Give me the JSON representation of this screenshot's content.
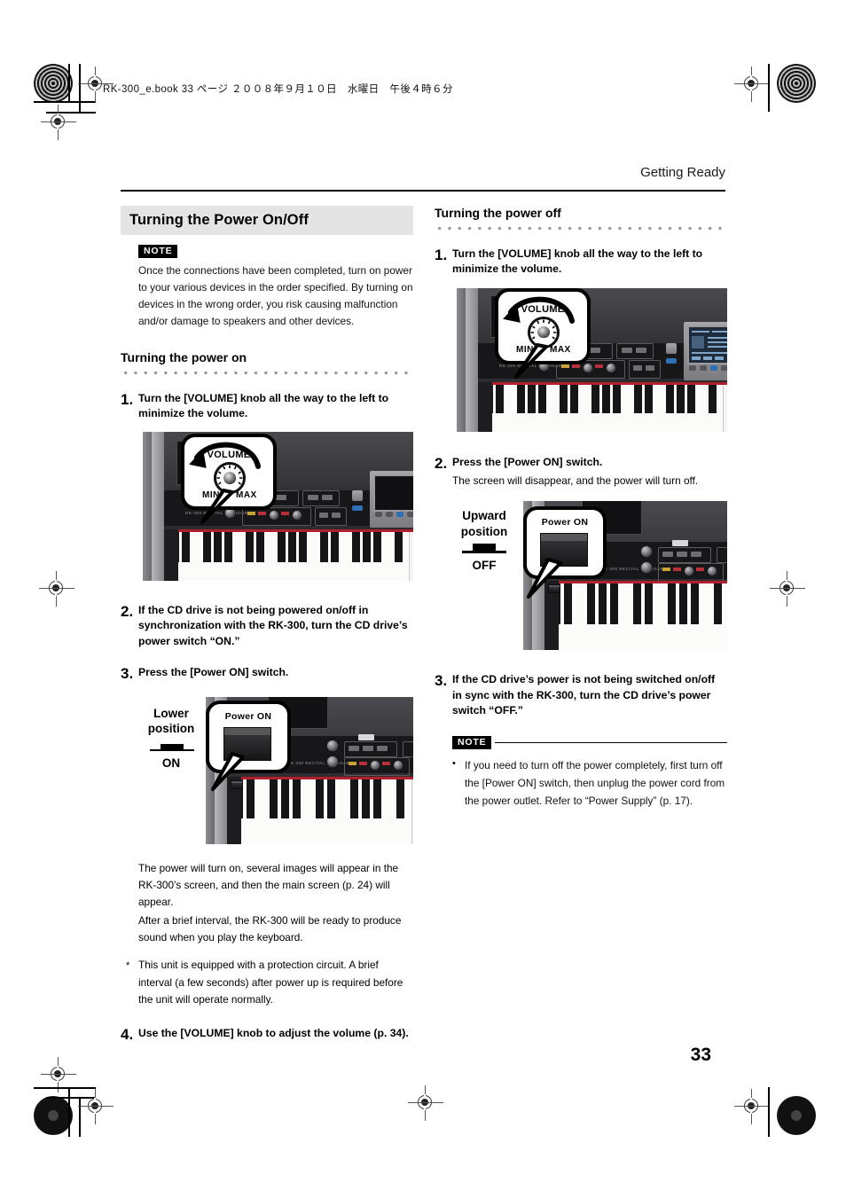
{
  "print_marks": {
    "filename_line": "RK-300_e.book  33 ページ  ２００８年９月１０日　水曜日　午後４時６分"
  },
  "running_head": "Getting Ready",
  "page_number": "33",
  "left_column": {
    "chapter_title": "Turning the Power On/Off",
    "note_badge": "NOTE",
    "note_text": "Once the connections have been completed, turn on power to your various devices in the order specified. By turning on devices in the wrong order, you risk causing malfunction and/or damage to speakers and other devices.",
    "sub_head": "Turning the power on",
    "steps": [
      {
        "num": "1.",
        "text": "Turn the [VOLUME] knob all the way to the left to minimize the volume."
      },
      {
        "num": "2.",
        "text": "If the CD drive is not being powered on/off in synchronization with the RK-300, turn the CD drive’s power switch “ON.”"
      },
      {
        "num": "3.",
        "text": "Press the [Power ON] switch."
      },
      {
        "num": "4.",
        "text": "Use the [VOLUME] knob to adjust the volume (p. 34)."
      }
    ],
    "figure_volume": {
      "bubble_label": "VOLUME",
      "min_label": "MIN",
      "max_label": "MAX",
      "brand": "Roland"
    },
    "figure_power": {
      "switch_label_line1": "Lower",
      "switch_label_line2": "position",
      "switch_state": "ON",
      "bubble_label": "Power ON"
    },
    "body_para_1": "The power will turn on, several images will appear in the RK-300’s screen, and then the main screen (p. 24) will appear.",
    "body_para_2": "After a brief interval, the RK-300 will be ready to produce sound when you play the keyboard.",
    "asterisk_mark": "*",
    "asterisk_text": "This unit is equipped with a protection circuit. A brief interval (a few seconds) after power up is required before the unit will operate normally."
  },
  "right_column": {
    "sub_head": "Turning the power off",
    "steps": [
      {
        "num": "1.",
        "text": "Turn the [VOLUME] knob all the way to the left to minimize the volume.",
        "sub": ""
      },
      {
        "num": "2.",
        "text": "Press the [Power ON] switch.",
        "sub": "The screen will disappear, and the power will turn off."
      },
      {
        "num": "3.",
        "text": "If the CD drive’s power is not being switched on/off in sync with the RK-300, turn the CD drive’s power switch “OFF.”",
        "sub": ""
      }
    ],
    "figure_volume": {
      "bubble_label": "VOLUME",
      "min_label": "MIN",
      "max_label": "MAX",
      "brand": "Roland"
    },
    "figure_power": {
      "switch_label_line1": "Upward",
      "switch_label_line2": "position",
      "switch_state": "OFF",
      "bubble_label": "Power ON"
    },
    "note_badge": "NOTE",
    "note_bullet": "•",
    "note_text": "If you need to turn off the power completely, first turn off the [Power ON] switch, then unplug the power cord from the power outlet. Refer to “Power Supply” (p. 17)."
  },
  "colors": {
    "title_band": "#e4e4e4",
    "rule": "#000000",
    "dot_rule": "#9a9a9a"
  }
}
